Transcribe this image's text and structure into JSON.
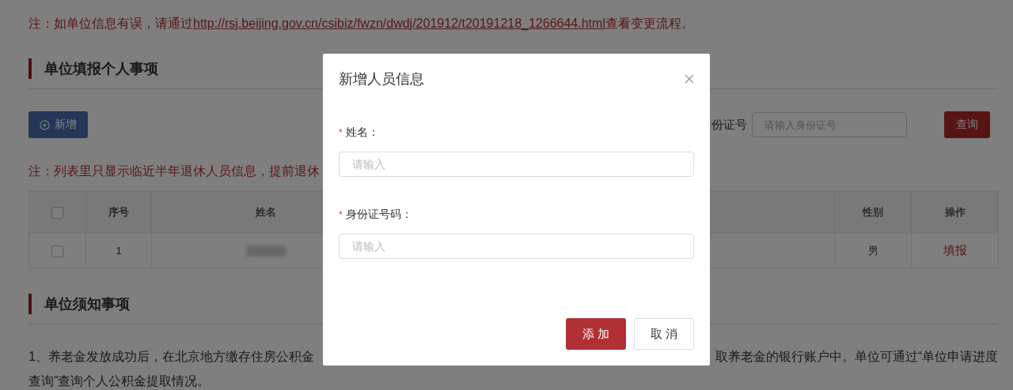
{
  "notice": {
    "prefix": "注：如单位信息有误，请通过",
    "link": "http://rsj.beijing.gov.cn/csibiz/fwzn/dwdj/201912/t20191218_1266644.html",
    "suffix": "查看变更流程。"
  },
  "section_1": {
    "title": "单位填报个人事项"
  },
  "toolbar": {
    "add_button": "新增",
    "search_label": "份证号",
    "search_field": {
      "placeholder": "请输入身份证号"
    },
    "query_button": "查询"
  },
  "list_note": "注：列表里只显示临近半年退休人员信息，提前退休",
  "table": {
    "header_checked": false,
    "columns": [
      "序号",
      "姓名",
      "性别",
      "操作"
    ],
    "rows": [
      {
        "checked": false,
        "index": "1",
        "gender": "男",
        "action": "填报"
      }
    ]
  },
  "section_2": {
    "title": "单位须知事项"
  },
  "paragraph_lines": [
    {
      "fragments": [
        "1、养老金发放成功后，在北京地方缴存住房公积金",
        "取养老金的银行账户中。单位可通过“单位申请进度"
      ]
    },
    {
      "fragments": [
        "查询”查询个人公积金提取情况。"
      ]
    }
  ],
  "dialog": {
    "title": "新增人员信息",
    "fields": [
      {
        "mark": "*",
        "label": "姓名：",
        "placeholder": "请输入"
      },
      {
        "mark": "*",
        "label": "身份证号码：",
        "placeholder": "请输入"
      }
    ],
    "buttons": [
      {
        "label": "添 加",
        "kind": "primary"
      },
      {
        "label": "取 消",
        "kind": "default"
      }
    ]
  }
}
